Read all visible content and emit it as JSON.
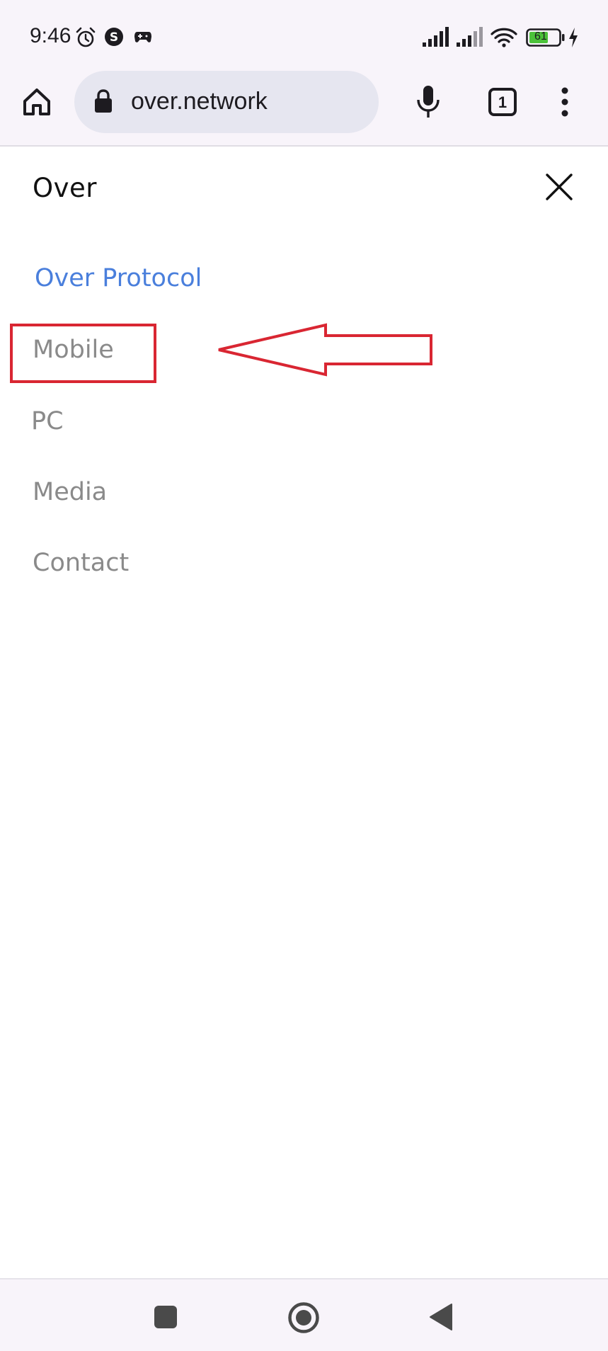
{
  "status_bar": {
    "time": "9:46",
    "battery_level": "61"
  },
  "browser": {
    "url": "over.network",
    "tab_count": "1"
  },
  "page": {
    "brand": "Over",
    "menu": [
      {
        "label": "Over Protocol",
        "active": true
      },
      {
        "label": "Mobile",
        "active": false
      },
      {
        "label": "PC",
        "active": false
      },
      {
        "label": "Media",
        "active": false
      },
      {
        "label": "Contact",
        "active": false
      }
    ]
  },
  "colors": {
    "accent": "#4a7fdc",
    "annotation": "#d92632",
    "menu_text": "#8a8a8a",
    "chrome_bg": "#f8f4fa",
    "omnibox_bg": "#e6e6f0"
  },
  "icons": {
    "status": [
      "alarm-icon",
      "s-app-icon",
      "gamepad-icon",
      "signal-icon",
      "wifi-icon",
      "battery-icon",
      "charging-icon"
    ],
    "toolbar": [
      "home-icon",
      "lock-icon",
      "mic-icon",
      "tab-switcher-icon",
      "more-vert-icon"
    ],
    "page": [
      "close-icon"
    ],
    "nav": [
      "recents-icon",
      "home-nav-icon",
      "back-icon"
    ]
  }
}
